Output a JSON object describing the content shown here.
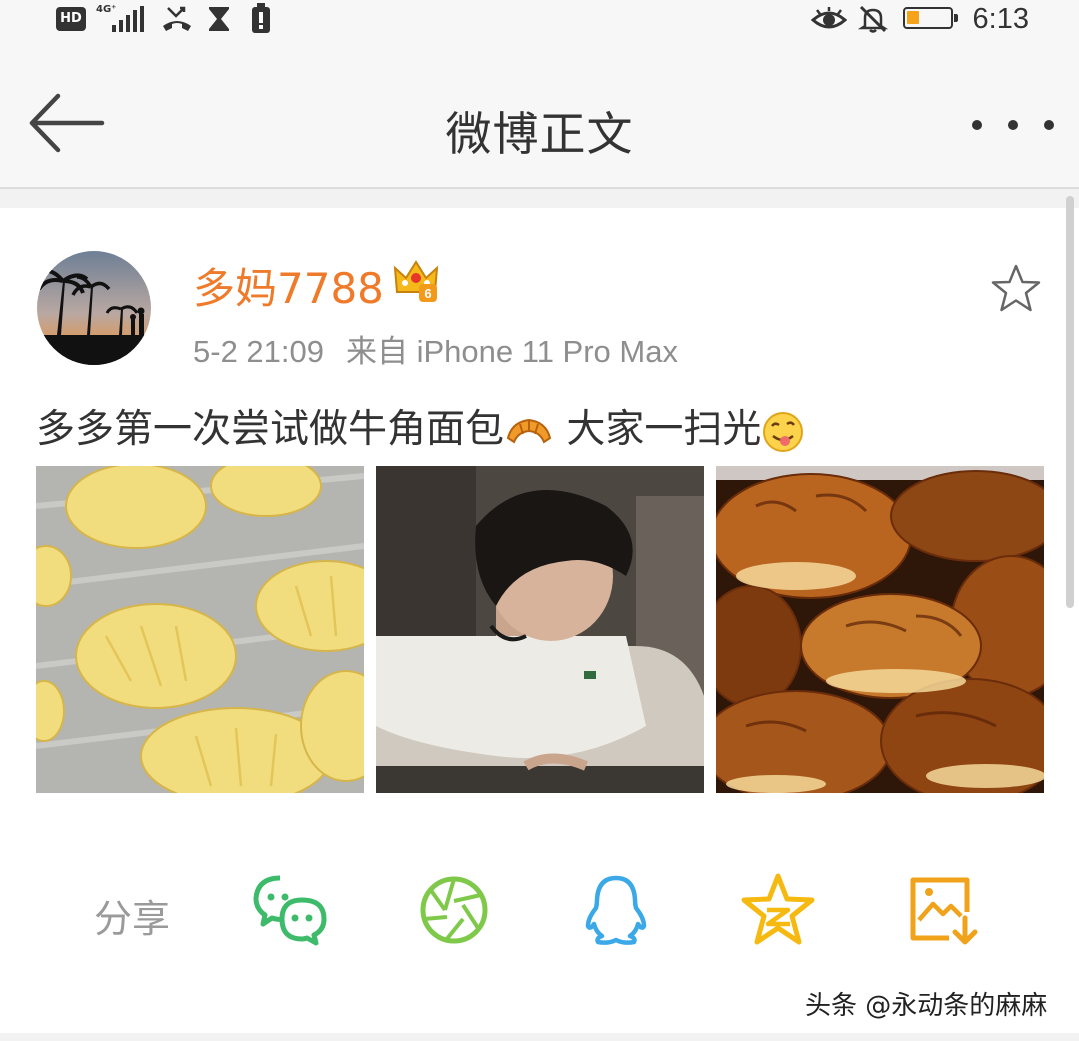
{
  "status_bar": {
    "hd": "HD",
    "network": "4G⁺",
    "time": "6:13",
    "battery_color": "#f5a31a"
  },
  "header": {
    "title": "微博正文",
    "back_icon": "back-arrow-icon",
    "more_icon": "more-dots-icon"
  },
  "post": {
    "username": "多妈7788",
    "username_color": "#ef7a2a",
    "vip_level": "6",
    "time": "5-2 21:09",
    "source": "来自 iPhone 11 Pro Max",
    "text_part1": "多多第一次尝试做牛角面包",
    "text_part2": " 大家一扫光",
    "photos": [
      "raw-croissants-on-foil",
      "girl-making-croissants",
      "baked-croissants"
    ]
  },
  "share": {
    "label": "分享",
    "targets": [
      "wechat-icon",
      "moments-icon",
      "qq-icon",
      "qzone-icon",
      "save-image-icon"
    ],
    "colors": {
      "wechat": "#3dbb6a",
      "moments": "#7fc94a",
      "qq": "#3ba9e8",
      "qzone": "#f5b90f",
      "save": "#f0a21a"
    }
  },
  "watermark": "头条 @永动条的麻麻"
}
